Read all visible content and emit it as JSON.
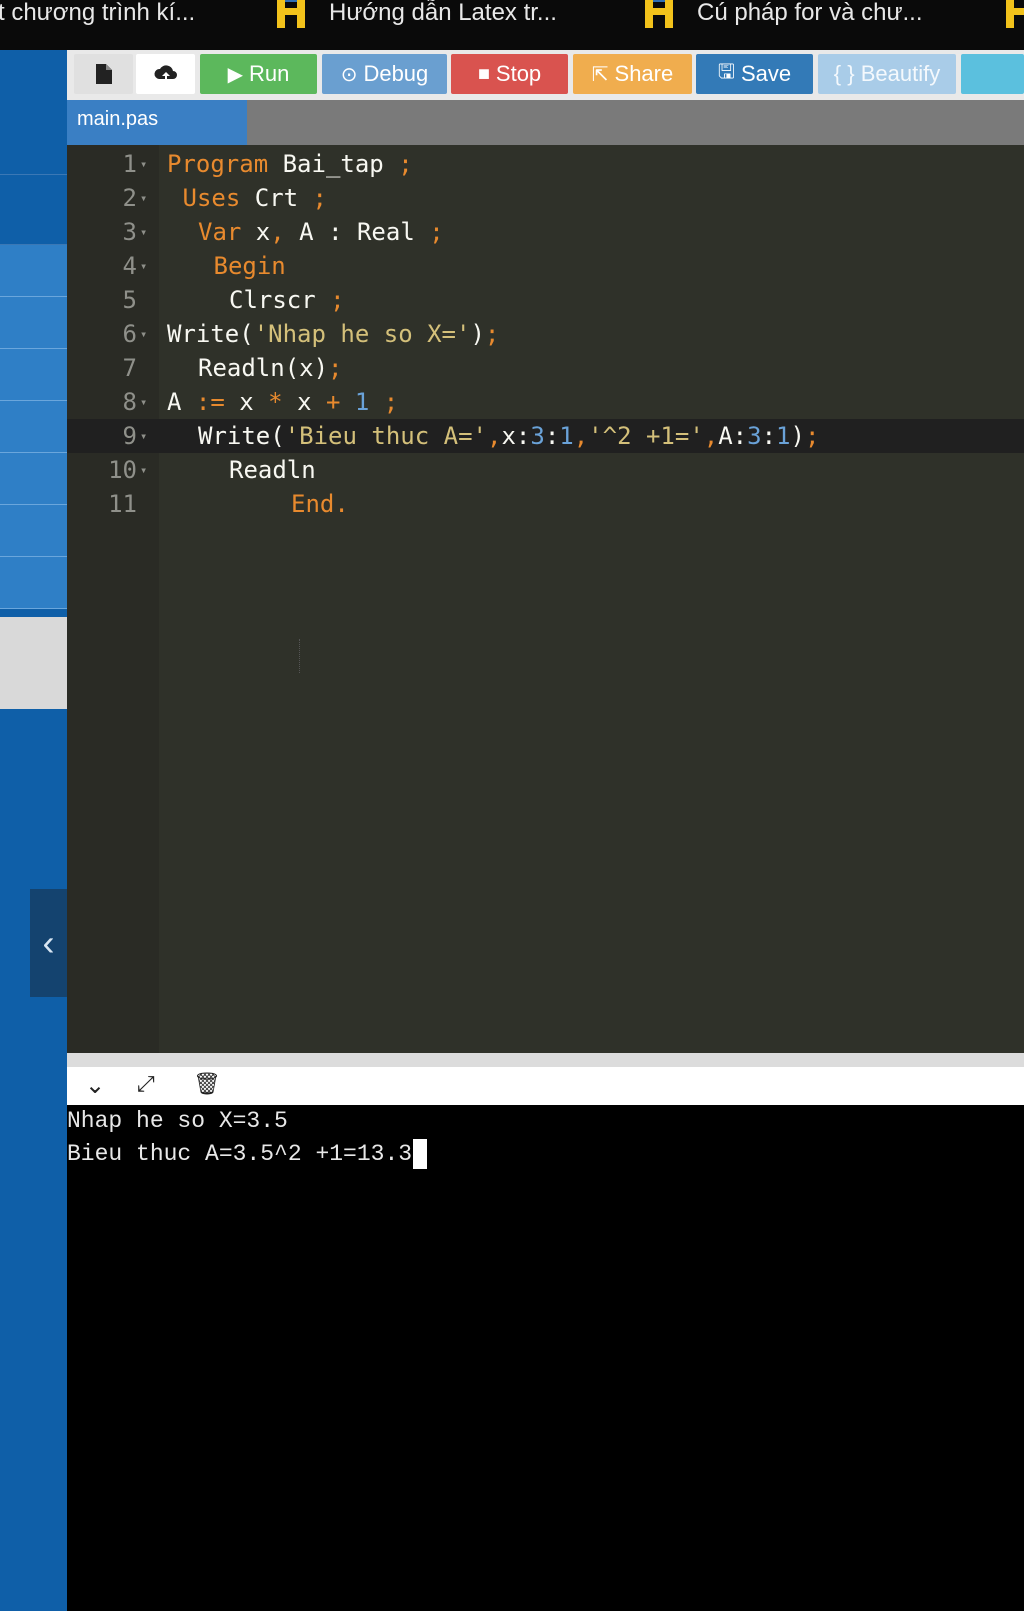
{
  "bookmarks": [
    {
      "label": "t chương trình kí...",
      "has_icon": false
    },
    {
      "label": "Hướng dẫn Latex tr...",
      "has_icon": true
    },
    {
      "label": "Cú pháp for và chư...",
      "has_icon": true
    }
  ],
  "toolbar": {
    "run_label": "Run",
    "debug_label": "Debug",
    "stop_label": "Stop",
    "share_label": "Share",
    "save_label": "Save",
    "beautify_label": "{ } Beautify"
  },
  "tab": {
    "filename": "main.pas"
  },
  "sidebar": {
    "collapse_glyph": "‹"
  },
  "editor": {
    "lines": [
      {
        "n": "1",
        "fold": true,
        "indent": 0,
        "tokens": [
          [
            "kw",
            "Program"
          ],
          [
            "txt",
            " Bai_tap "
          ],
          [
            "op",
            ";"
          ]
        ]
      },
      {
        "n": "2",
        "fold": true,
        "indent": 1,
        "tokens": [
          [
            "kw",
            "Uses"
          ],
          [
            "txt",
            " Crt "
          ],
          [
            "op",
            ";"
          ]
        ]
      },
      {
        "n": "3",
        "fold": true,
        "indent": 2,
        "tokens": [
          [
            "kw",
            "Var"
          ],
          [
            "txt",
            " x"
          ],
          [
            "op",
            ","
          ],
          [
            "txt",
            " A : Real "
          ],
          [
            "op",
            ";"
          ]
        ]
      },
      {
        "n": "4",
        "fold": true,
        "indent": 3,
        "tokens": [
          [
            "kw",
            "Begin"
          ]
        ]
      },
      {
        "n": "5",
        "fold": false,
        "indent": 4,
        "tokens": [
          [
            "txt",
            "Clrscr "
          ],
          [
            "op",
            ";"
          ]
        ]
      },
      {
        "n": "6",
        "fold": true,
        "indent": 0,
        "tokens": [
          [
            "txt",
            "Write("
          ],
          [
            "str",
            "'Nhap he so X='"
          ],
          [
            "txt",
            ")"
          ],
          [
            "op",
            ";"
          ]
        ]
      },
      {
        "n": "7",
        "fold": false,
        "indent": 2,
        "tokens": [
          [
            "txt",
            "Readln(x)"
          ],
          [
            "op",
            ";"
          ]
        ]
      },
      {
        "n": "8",
        "fold": true,
        "indent": 0,
        "tokens": [
          [
            "txt",
            "A "
          ],
          [
            "op",
            ":="
          ],
          [
            "txt",
            " x "
          ],
          [
            "op",
            "*"
          ],
          [
            "txt",
            " x "
          ],
          [
            "op",
            "+"
          ],
          [
            "txt",
            " "
          ],
          [
            "num",
            "1"
          ],
          [
            "txt",
            " "
          ],
          [
            "op",
            ";"
          ]
        ]
      },
      {
        "n": "9",
        "fold": true,
        "indent": 2,
        "tokens": [
          [
            "txt",
            "Write("
          ],
          [
            "str",
            "'Bieu thuc A='"
          ],
          [
            "op",
            ","
          ],
          [
            "txt",
            "x:"
          ],
          [
            "num",
            "3"
          ],
          [
            "txt",
            ":"
          ],
          [
            "num",
            "1"
          ],
          [
            "op",
            ","
          ],
          [
            "str",
            "'^2 +1='"
          ],
          [
            "op",
            ","
          ],
          [
            "txt",
            "A:"
          ],
          [
            "num",
            "3"
          ],
          [
            "txt",
            ":"
          ],
          [
            "num",
            "1"
          ],
          [
            "txt",
            ")"
          ],
          [
            "op",
            ";"
          ]
        ]
      },
      {
        "n": "10",
        "fold": true,
        "indent": 4,
        "tokens": [
          [
            "txt",
            "Readln"
          ]
        ]
      },
      {
        "n": "11",
        "fold": false,
        "indent": 8,
        "tokens": [
          [
            "kw",
            "End."
          ]
        ]
      }
    ],
    "active_line": 9
  },
  "console": {
    "output": [
      "Nhap he so X=3.5",
      "Bieu thuc A=3.5^2 +1=13.3"
    ]
  }
}
